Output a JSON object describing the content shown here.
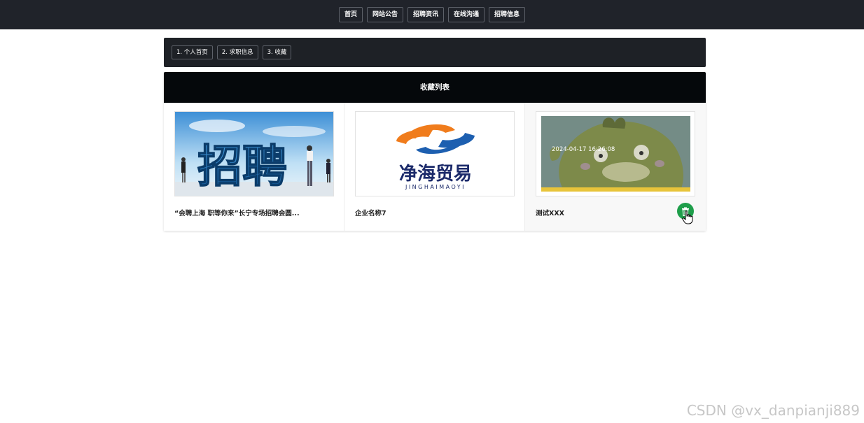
{
  "topnav": {
    "items": [
      "首页",
      "网站公告",
      "招聘资讯",
      "在线沟通",
      "招聘信息"
    ]
  },
  "breadcrumb": {
    "items": [
      "1. 个人首页",
      "2. 求职信息",
      "3. 收藏"
    ]
  },
  "favorites": {
    "header": "收藏列表",
    "cards": [
      {
        "title": "“会聘上海 职等你来”长宁专场招聘会圆...",
        "image_text": "招聘"
      },
      {
        "title": "企业名称7",
        "image_logo_text": "净海贸易",
        "image_logo_sub": "JINGHAIMAOYI"
      },
      {
        "title": "测试XXX",
        "image_timestamp": "2024-04-17 16:26:08"
      }
    ]
  },
  "icons": {
    "delete": "trash-icon",
    "cursor": "hand-pointer-icon"
  },
  "colors": {
    "nav_bg": "#20232a",
    "header_bg": "#05080b",
    "delete_btn": "#1e9e4a"
  },
  "watermark": "CSDN @vx_danpianji889"
}
